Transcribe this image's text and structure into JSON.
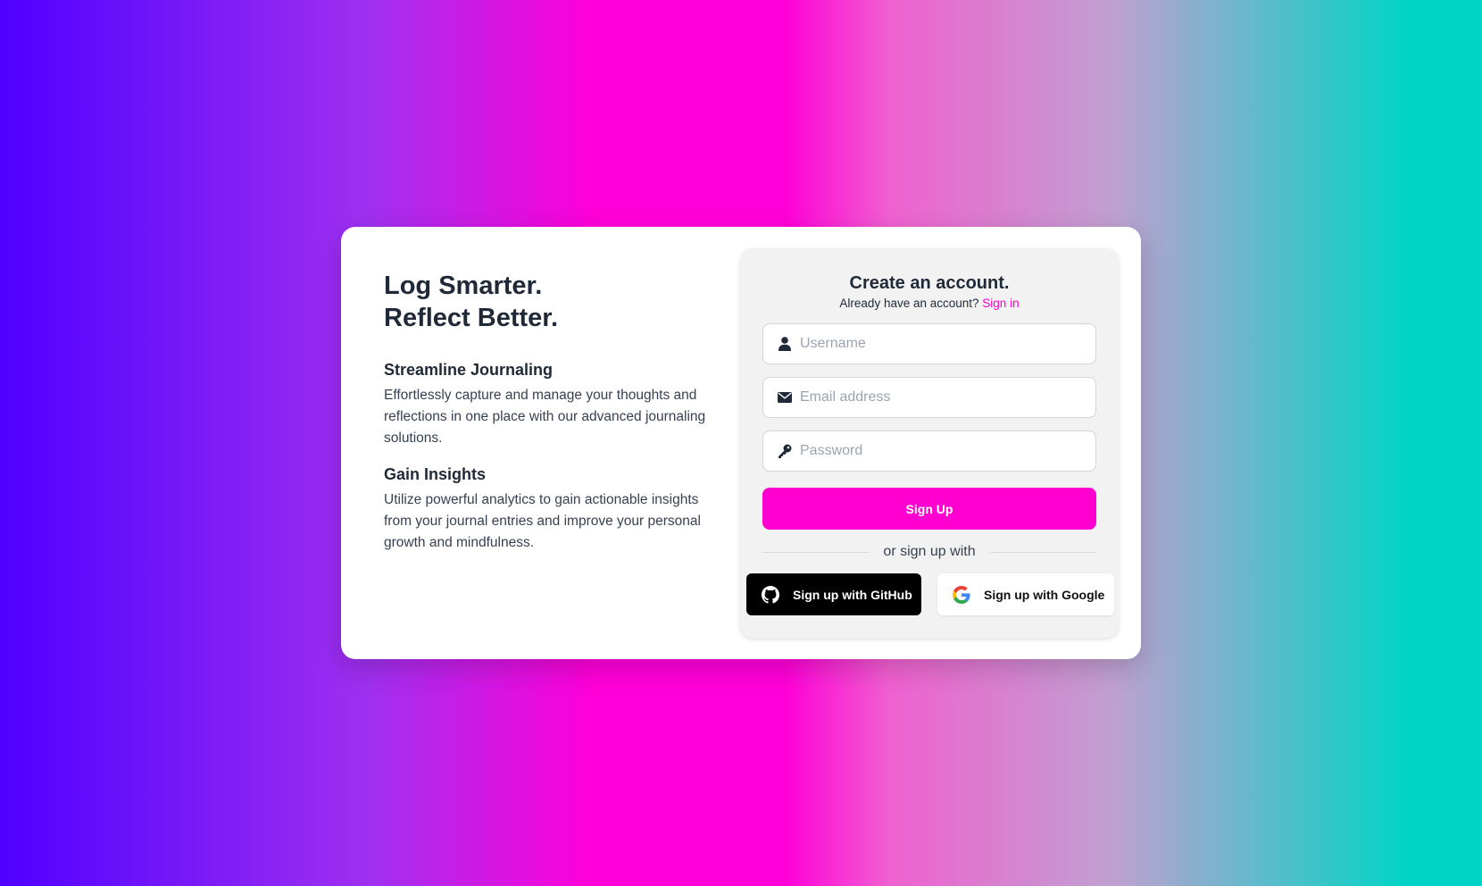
{
  "hero": {
    "headline_line1": "Log Smarter.",
    "headline_line2": "Reflect Better."
  },
  "features": [
    {
      "title": "Streamline Journaling",
      "text": "Effortlessly capture and manage your thoughts and reflections in one place with our advanced journaling solutions."
    },
    {
      "title": "Gain Insights",
      "text": "Utilize powerful analytics to gain actionable insights from your journal entries and improve your personal growth and mindfulness."
    }
  ],
  "signup": {
    "title": "Create an account.",
    "have_account": "Already have an account?",
    "signin_link": "Sign in",
    "username_placeholder": "Username",
    "email_placeholder": "Email address",
    "password_placeholder": "Password",
    "submit_label": "Sign Up",
    "divider_text": "or sign up with",
    "github_label": "Sign up with GitHub",
    "google_label": "Sign up with Google"
  },
  "icons": {
    "username": "user-icon",
    "email": "envelope-icon",
    "password": "key-icon",
    "github": "github-icon",
    "google": "google-icon"
  },
  "colors": {
    "accent": "#ff00d0",
    "text": "#1f2937",
    "panel_bg": "#f2f2f2",
    "github_bg": "#000000"
  }
}
